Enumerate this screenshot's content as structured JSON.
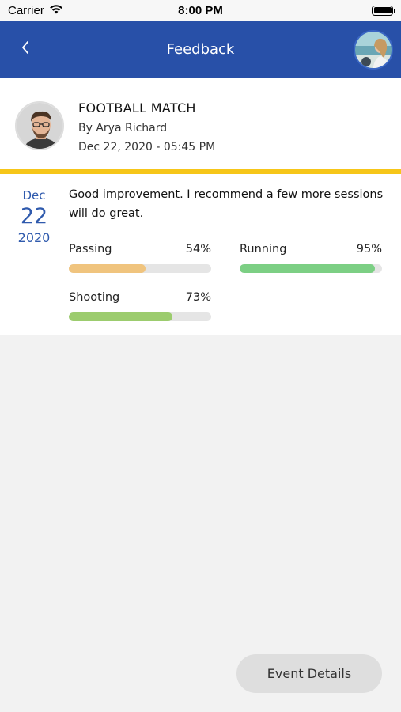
{
  "status_bar": {
    "carrier": "Carrier",
    "time": "8:00 PM"
  },
  "header": {
    "title": "Feedback",
    "back_icon": "chevron-left-icon",
    "color": "#2850a8"
  },
  "event": {
    "title": "FOOTBALL MATCH",
    "author": "By Arya Richard",
    "datetime": "Dec 22, 2020 - 05:45 PM"
  },
  "feedback": {
    "date": {
      "month": "Dec",
      "day": "22",
      "year": "2020"
    },
    "comment": "Good improvement. I recommend a few more sessions will do great.",
    "skills": [
      {
        "label": "Passing",
        "percent_label": "54%",
        "value": 0.54,
        "color": "#f0c47e"
      },
      {
        "label": "Running",
        "percent_label": "95%",
        "value": 0.95,
        "color": "#7ccf84"
      },
      {
        "label": "Shooting",
        "percent_label": "73%",
        "value": 0.73,
        "color": "#9ccc6e"
      }
    ]
  },
  "footer": {
    "event_details_label": "Event Details"
  },
  "colors": {
    "accent": "#f6c619",
    "date_blue": "#2f5aad"
  }
}
